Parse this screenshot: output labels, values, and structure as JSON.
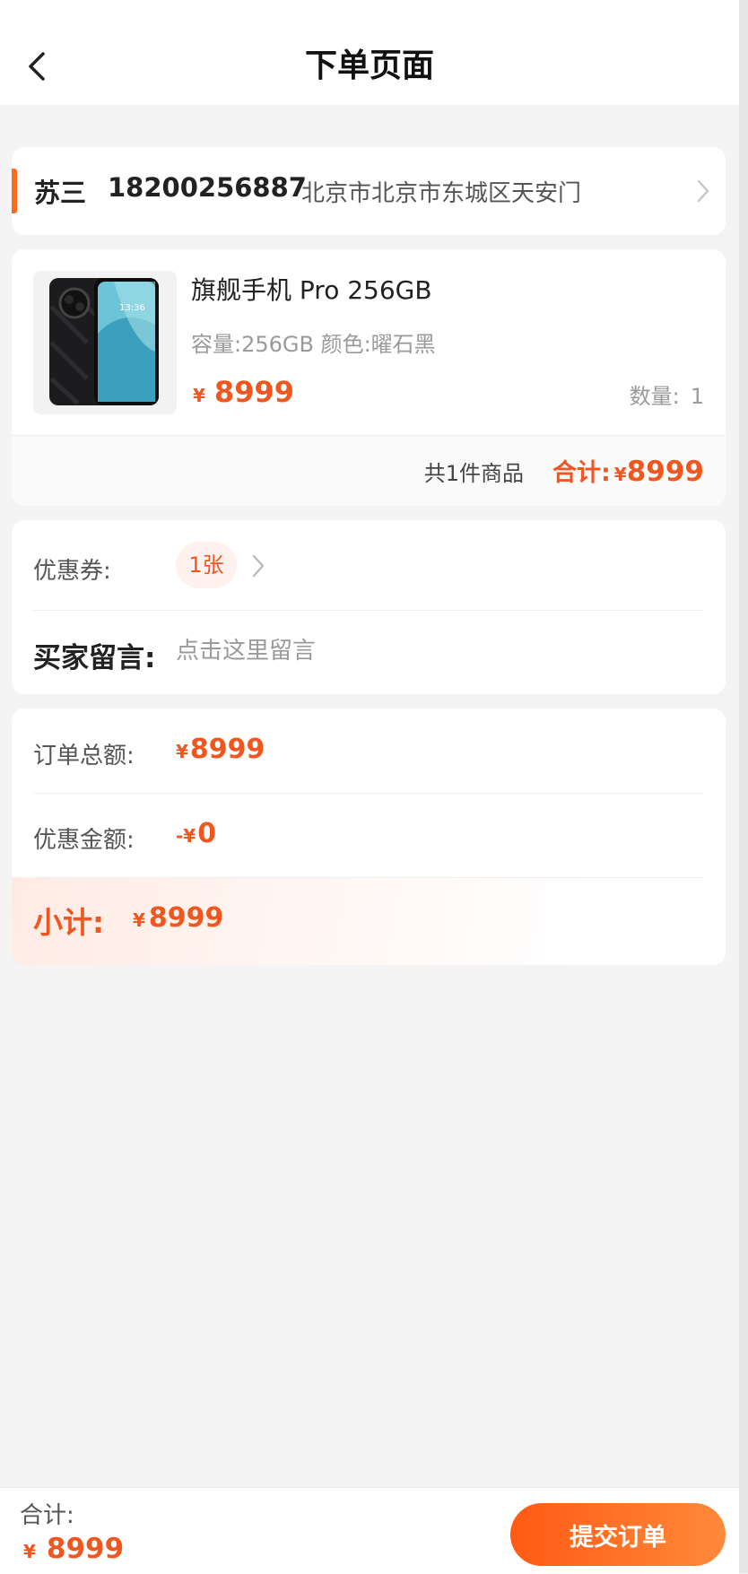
{
  "header": {
    "title": "下单页面"
  },
  "address": {
    "name": "苏三",
    "phone": "18200256887",
    "detail": "北京市北京市东城区天安门"
  },
  "product": {
    "name": "旗舰手机 Pro 256GB",
    "spec": "容量:256GB 颜色:曜石黑",
    "currency": "¥",
    "price": "8999",
    "qty_label": "数量:",
    "qty": "1",
    "count_text": "共1件商品",
    "total_label": "合计:",
    "total_currency": "¥",
    "total": "8999",
    "image_screen_text": "13:36"
  },
  "coupon": {
    "label": "优惠券:",
    "badge": "1张"
  },
  "message": {
    "label": "买家留言:",
    "placeholder": "点击这里留言"
  },
  "totals": {
    "order_total_label": "订单总额:",
    "order_total_currency": "¥",
    "order_total": "8999",
    "discount_label": "优惠金额:",
    "discount_currency": "-¥",
    "discount": "0",
    "subtotal_label": "小计:",
    "subtotal_currency": "¥",
    "subtotal": "8999"
  },
  "bottom_bar": {
    "label": "合计:",
    "currency": "¥",
    "amount": "8999",
    "submit_label": "提交订单"
  },
  "colors": {
    "accent": "#f0571f",
    "background": "#f4f4f4",
    "card": "#ffffff"
  },
  "icons": {
    "back": "back-arrow-icon",
    "chevron": "chevron-right-icon"
  }
}
